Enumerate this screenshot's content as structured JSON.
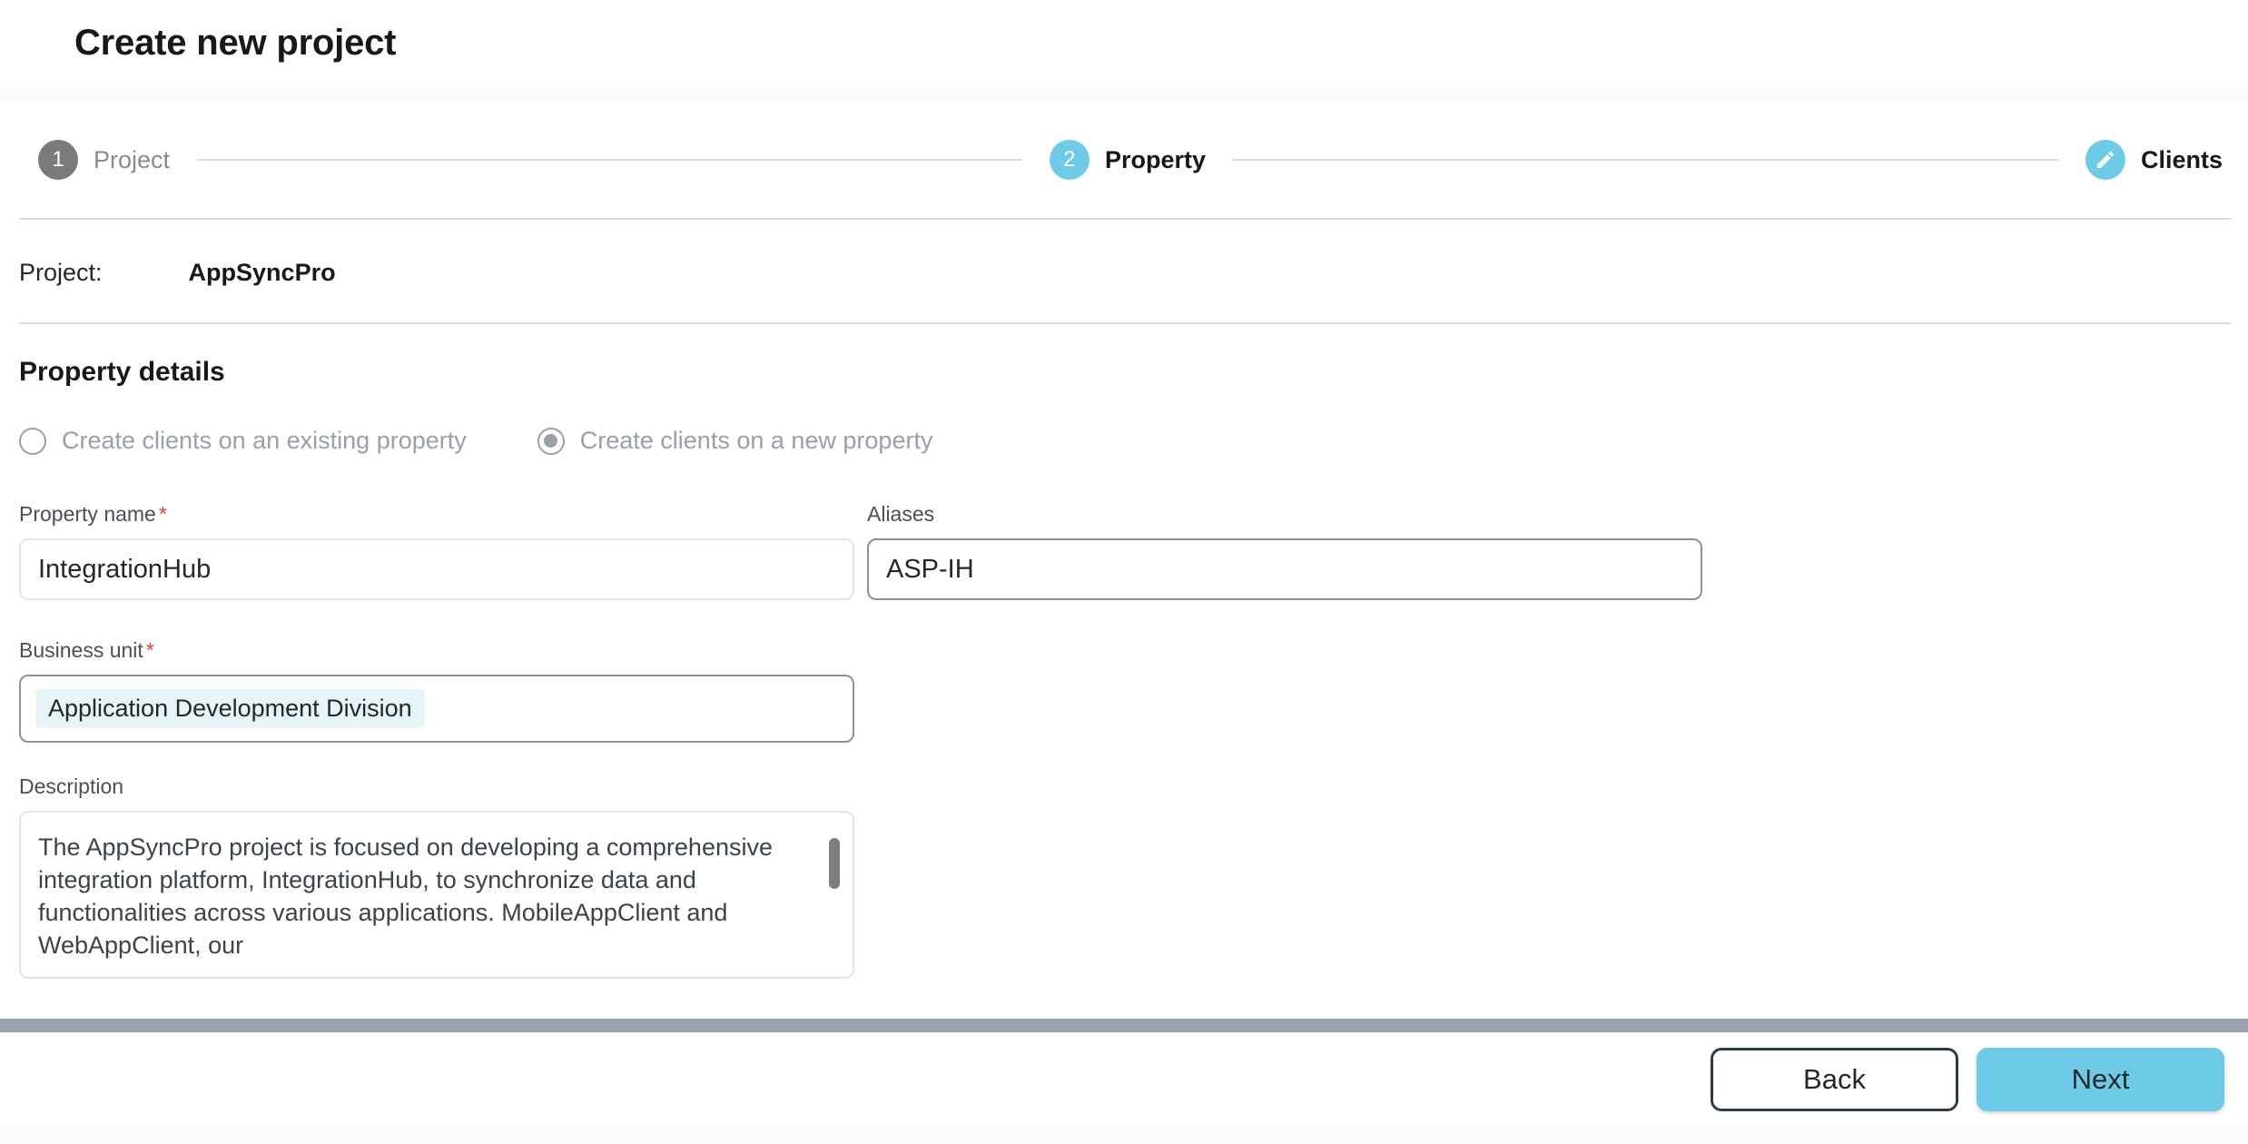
{
  "header": {
    "title": "Create new project"
  },
  "stepper": {
    "steps": [
      {
        "badge": "1",
        "label": "Project",
        "state": "done",
        "icon": ""
      },
      {
        "badge": "2",
        "label": "Property",
        "state": "current",
        "icon": ""
      },
      {
        "badge": "",
        "label": "Clients",
        "state": "future",
        "icon": "pencil-icon"
      }
    ]
  },
  "project": {
    "key_label": "Project:",
    "value": "AppSyncPro"
  },
  "section": {
    "title": "Property details"
  },
  "radios": {
    "options": [
      {
        "label": "Create clients on an existing property",
        "selected": false
      },
      {
        "label": "Create clients on a new property",
        "selected": true
      }
    ]
  },
  "fields": {
    "property_name": {
      "label": "Property name",
      "required": "*",
      "value": "IntegrationHub",
      "placeholder": ""
    },
    "aliases": {
      "label": "Aliases",
      "required": "",
      "value": "ASP-IH",
      "placeholder": ""
    },
    "business_unit": {
      "label": "Business unit",
      "required": "*",
      "chip": "Application Development Division",
      "placeholder": ""
    },
    "description": {
      "label": "Description",
      "required": "",
      "value": "The AppSyncPro project is focused on developing a comprehensive integration platform, IntegrationHub, to synchronize data and functionalities across various applications. MobileAppClient and WebAppClient, our",
      "placeholder": ""
    }
  },
  "footer": {
    "back_label": "Back",
    "next_label": "Next"
  },
  "colors": {
    "accent": "#6dcbe8",
    "step_done": "#7b7b7b",
    "required": "#e8392c",
    "chip_bg": "#e7f4f8",
    "footer_bar": "#9ba3b1"
  }
}
